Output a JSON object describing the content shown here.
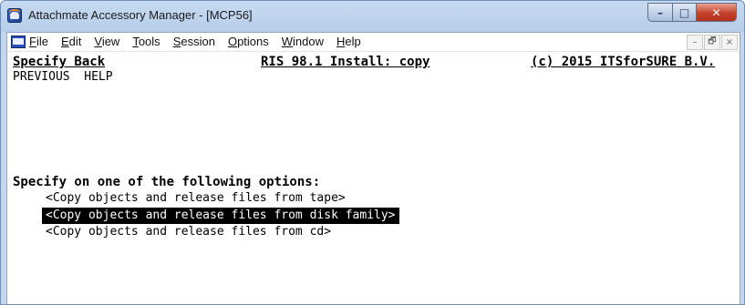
{
  "window": {
    "title": "Attachmate Accessory Manager - [MCP56]",
    "controls": {
      "minimize": "–",
      "maximize": "□",
      "close": "✕"
    }
  },
  "menubar": {
    "items": [
      {
        "label": "File",
        "mnemonic": "F",
        "rest": "ile"
      },
      {
        "label": "Edit",
        "mnemonic": "E",
        "rest": "dit"
      },
      {
        "label": "View",
        "mnemonic": "V",
        "rest": "iew"
      },
      {
        "label": "Tools",
        "mnemonic": "T",
        "rest": "ools"
      },
      {
        "label": "Session",
        "mnemonic": "S",
        "rest": "ession"
      },
      {
        "label": "Options",
        "mnemonic": "O",
        "rest": "ptions"
      },
      {
        "label": "Window",
        "mnemonic": "W",
        "rest": "indow"
      },
      {
        "label": "Help",
        "mnemonic": "H",
        "rest": "elp"
      }
    ],
    "mdi_controls": {
      "minimize": "–",
      "restore": "🗗",
      "close": "×"
    }
  },
  "terminal": {
    "header": {
      "left": "Specify Back",
      "center": "RIS 98.1 Install: copy",
      "right": "(c) 2015 ITSforSURE B.V."
    },
    "function_keys": "PREVIOUS  HELP",
    "prompt": "Specify on one of the following options:",
    "options": [
      "<Copy objects and release files from tape>",
      "<Copy objects and release files from disk family>",
      "<Copy objects and release files from cd>"
    ],
    "selected_option_index": 1
  }
}
